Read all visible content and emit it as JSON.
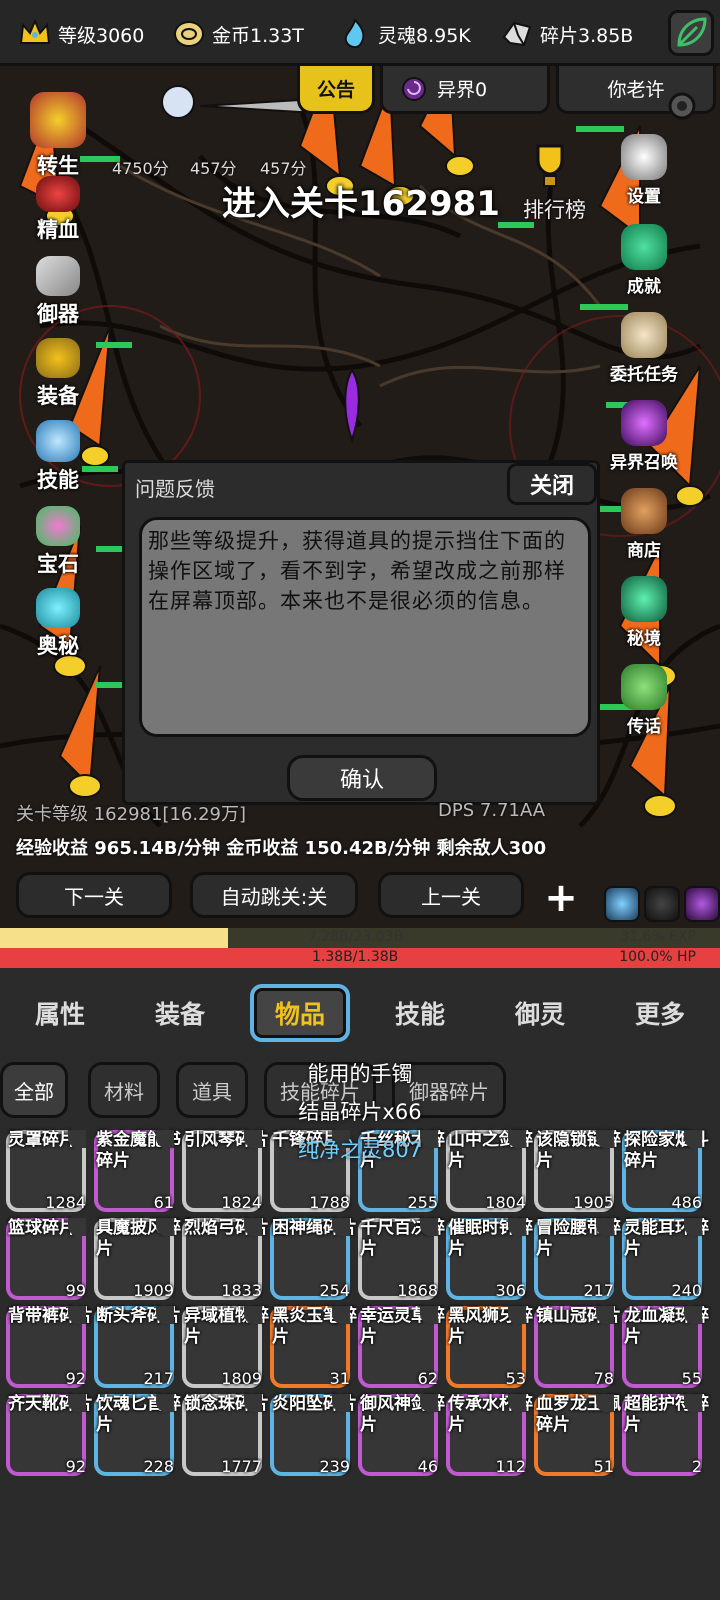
{
  "resources": {
    "level": "等级3060",
    "gold": "金币1.33T",
    "soul": "灵魂8.95K",
    "shard": "碎片3.85B"
  },
  "top_tabs": {
    "notice": "公告",
    "realm": "异界0",
    "player": "你老许"
  },
  "left_menu": [
    "转生",
    "精血",
    "御器",
    "装备",
    "技能",
    "宝石",
    "奥秘"
  ],
  "right_menu": [
    "设置",
    "成就",
    "委托任务",
    "异界召唤",
    "商店",
    "秘境",
    "传话"
  ],
  "scores": [
    "4750分",
    "457分",
    "457分"
  ],
  "stage_title": "进入关卡162981",
  "ranking_label": "排行榜",
  "dialog": {
    "title": "问题反馈",
    "close_label": "关闭",
    "text": "那些等级提升，获得道具的提示挡住下面的操作区域了，看不到字，希望改成之前那样在屏幕顶部。本来也不是很必须的信息。",
    "confirm_label": "确认"
  },
  "stage_info": {
    "stage_level": "关卡等级 162981[16.29万]",
    "dps": "DPS 7.71AA",
    "income": "经验收益 965.14B/分钟 金币收益 150.42B/分钟 剩余敌人300"
  },
  "nav": {
    "next": "下一关",
    "auto": "自动跳关:关",
    "prev": "上一关",
    "plus": "+"
  },
  "bars": {
    "exp_text": "7.28B/23.03B",
    "exp_pct": "31.6% EXP",
    "exp_fraction": 0.316,
    "hp_text": "1.38B/1.38B",
    "hp_pct": "100.0%  HP",
    "hp_fraction": 1.0
  },
  "main_tabs": [
    "属性",
    "装备",
    "物品",
    "技能",
    "御灵",
    "更多"
  ],
  "filters": [
    "全部",
    "材料",
    "道具",
    "技能碎片",
    "御器碎片"
  ],
  "toasts": [
    "能用的手镯",
    "结晶碎片x66",
    "纯净之灵807"
  ],
  "items": [
    {
      "name": "灵罩碎片",
      "count": "1284",
      "rarity": "w"
    },
    {
      "name": "紫金魔能书碎片",
      "count": "61",
      "rarity": "p"
    },
    {
      "name": "引风琴碎片",
      "count": "1824",
      "rarity": "w"
    },
    {
      "name": "千锋碎片",
      "count": "1788",
      "rarity": "w"
    },
    {
      "name": "千丝秘术碎片",
      "count": "255",
      "rarity": "b"
    },
    {
      "name": "山中之剑碎片",
      "count": "1804",
      "rarity": "w"
    },
    {
      "name": "该隐锁链碎片",
      "count": "1905",
      "rarity": "w"
    },
    {
      "name": "探险家烟斗碎片",
      "count": "486",
      "rarity": "b"
    },
    {
      "name": "篮球碎片",
      "count": "99",
      "rarity": "p"
    },
    {
      "name": "具魔披风碎片",
      "count": "1909",
      "rarity": "w"
    },
    {
      "name": "烈焰弓碎片",
      "count": "1833",
      "rarity": "w"
    },
    {
      "name": "困神绳碎片",
      "count": "254",
      "rarity": "b"
    },
    {
      "name": "千尺百决碎片",
      "count": "1868",
      "rarity": "w"
    },
    {
      "name": "催眠时钟碎片",
      "count": "306",
      "rarity": "b"
    },
    {
      "name": "冒险腰带碎片",
      "count": "217",
      "rarity": "b"
    },
    {
      "name": "灵能耳环碎片",
      "count": "240",
      "rarity": "b"
    },
    {
      "name": "背带裤碎片",
      "count": "92",
      "rarity": "p"
    },
    {
      "name": "断头斧碎片",
      "count": "217",
      "rarity": "b"
    },
    {
      "name": "异域植物碎片",
      "count": "1809",
      "rarity": "w"
    },
    {
      "name": "黑炎玉笔碎片",
      "count": "31",
      "rarity": "o"
    },
    {
      "name": "幸运灵草碎片",
      "count": "62",
      "rarity": "p"
    },
    {
      "name": "黑风狮牙碎片",
      "count": "53",
      "rarity": "o"
    },
    {
      "name": "镇山冠碎片",
      "count": "78",
      "rarity": "p"
    },
    {
      "name": "龙血凝珠碎片",
      "count": "55",
      "rarity": "p"
    },
    {
      "name": "齐天靴碎片",
      "count": "92",
      "rarity": "p"
    },
    {
      "name": "饮魂匕首碎片",
      "count": "228",
      "rarity": "b"
    },
    {
      "name": "锁念珠碎片",
      "count": "1777",
      "rarity": "w"
    },
    {
      "name": "炎阳坠碎片",
      "count": "239",
      "rarity": "b"
    },
    {
      "name": "御风神剑碎片",
      "count": "46",
      "rarity": "p"
    },
    {
      "name": "传承水杯碎片",
      "count": "112",
      "rarity": "p"
    },
    {
      "name": "血罗龙王佩碎片",
      "count": "51",
      "rarity": "o"
    },
    {
      "name": "超能护符碎片",
      "count": "2",
      "rarity": "p"
    }
  ]
}
